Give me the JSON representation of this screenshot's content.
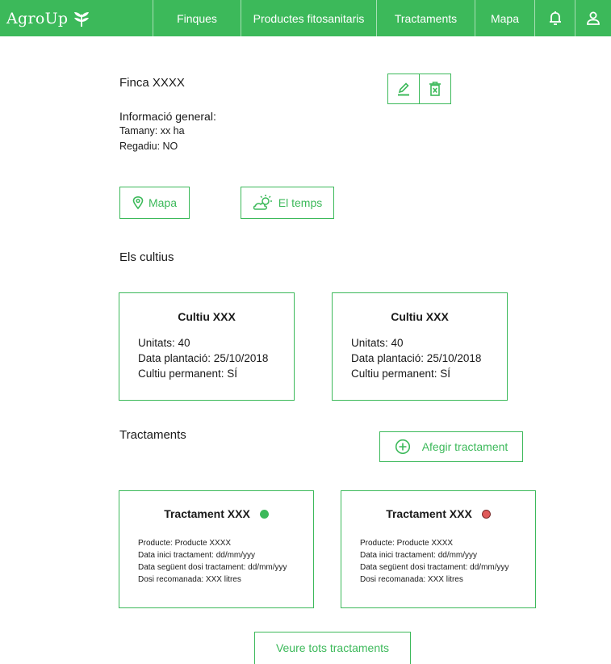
{
  "nav": {
    "logo_text": "AgroUp",
    "items": [
      {
        "label": "Finques"
      },
      {
        "label": "Productes fitosanitaris"
      },
      {
        "label": "Tractaments"
      },
      {
        "label": "Mapa"
      }
    ],
    "icons": [
      "bell-icon",
      "user-icon"
    ]
  },
  "farm": {
    "title": "Finca XXXX",
    "info_title": "Informació general:",
    "size_line": "Tamany:  xx ha",
    "irrigation_line": "Regadiu: NO"
  },
  "actions": {
    "edit_icon": "pencil-icon",
    "delete_icon": "trash-icon",
    "map_label": "Mapa",
    "weather_label": "El temps"
  },
  "crops": {
    "section_title": "Els cultius",
    "cards": [
      {
        "name": "Cultiu XXX",
        "units": "Unitats: 40",
        "planted": "Data plantació: 25/10/2018",
        "permanent": "Cultiu permanent: SÍ"
      },
      {
        "name": "Cultiu XXX",
        "units": "Unitats: 40",
        "planted": "Data plantació: 25/10/2018",
        "permanent": "Cultiu permanent: SÍ"
      }
    ]
  },
  "treatments": {
    "section_title": "Tractaments",
    "add_label": "Afegir tractament",
    "view_all_label": "Veure tots tractaments",
    "cards": [
      {
        "name": "Tractament XXX",
        "status_color": "#3cb95a",
        "product": "Producte: Producte XXXX",
        "start": "Data inici tractament: dd/mm/yyy",
        "next": "Data següent dosi tractament: dd/mm/yyy",
        "dose": "Dosi recomanada: XXX litres"
      },
      {
        "name": "Tractament XXX",
        "status_color": "#e05a5a",
        "product": "Producte: Producte XXXX",
        "start": "Data inici tractament: dd/mm/yyy",
        "next": "Data següent dosi tractament: dd/mm/yyy",
        "dose": "Dosi recomanada: XXX litres"
      }
    ]
  },
  "colors": {
    "brand": "#3cb95a",
    "status_ok": "#3cb95a",
    "status_alert": "#e05a5a"
  }
}
